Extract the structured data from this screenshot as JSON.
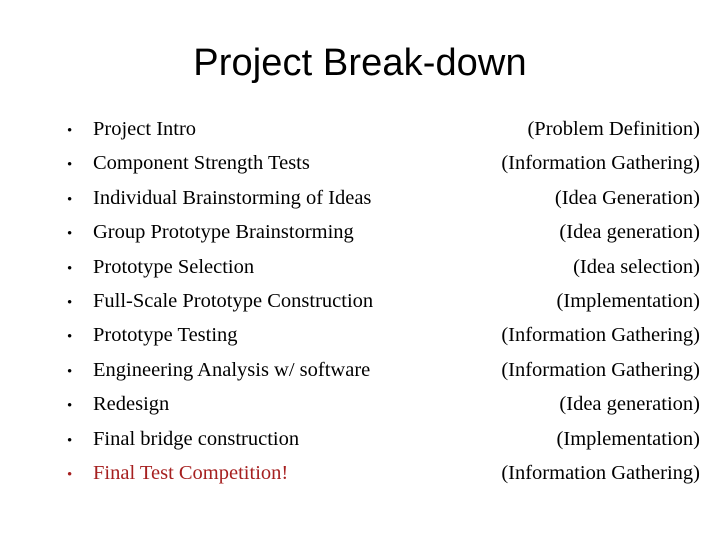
{
  "slide": {
    "title": "Project Break-down",
    "background_color": "#ffffff",
    "text_color": "#000000",
    "highlight_color": "#a62020",
    "bullet_glyph": "•"
  },
  "items": [
    {
      "task": "Project Intro",
      "phase": "(Problem Definition)",
      "highlight": false,
      "overrun": false
    },
    {
      "task": "Component Strength Tests",
      "phase": "(Information Gathering)",
      "highlight": false,
      "overrun": false
    },
    {
      "task": "Individual Brainstorming of Ideas",
      "phase": "(Idea Generation)",
      "highlight": false,
      "overrun": true
    },
    {
      "task": "Group Prototype Brainstorming",
      "phase": "(Idea generation)",
      "highlight": false,
      "overrun": false
    },
    {
      "task": "Prototype Selection",
      "phase": "(Idea selection)",
      "highlight": false,
      "overrun": false
    },
    {
      "task": "Full-Scale Prototype Construction",
      "phase": "(Implementation)",
      "highlight": false,
      "overrun": true
    },
    {
      "task": "Prototype Testing",
      "phase": "(Information Gathering)",
      "highlight": false,
      "overrun": false
    },
    {
      "task": "Engineering Analysis w/ software",
      "phase": "(Information Gathering)",
      "highlight": false,
      "overrun": true
    },
    {
      "task": "Redesign",
      "phase": "(Idea generation)",
      "highlight": false,
      "overrun": false
    },
    {
      "task": "Final bridge construction",
      "phase": "(Implementation)",
      "highlight": false,
      "overrun": false
    },
    {
      "task": "Final Test Competition!",
      "phase": "(Information Gathering)",
      "highlight": true,
      "overrun": false
    }
  ]
}
